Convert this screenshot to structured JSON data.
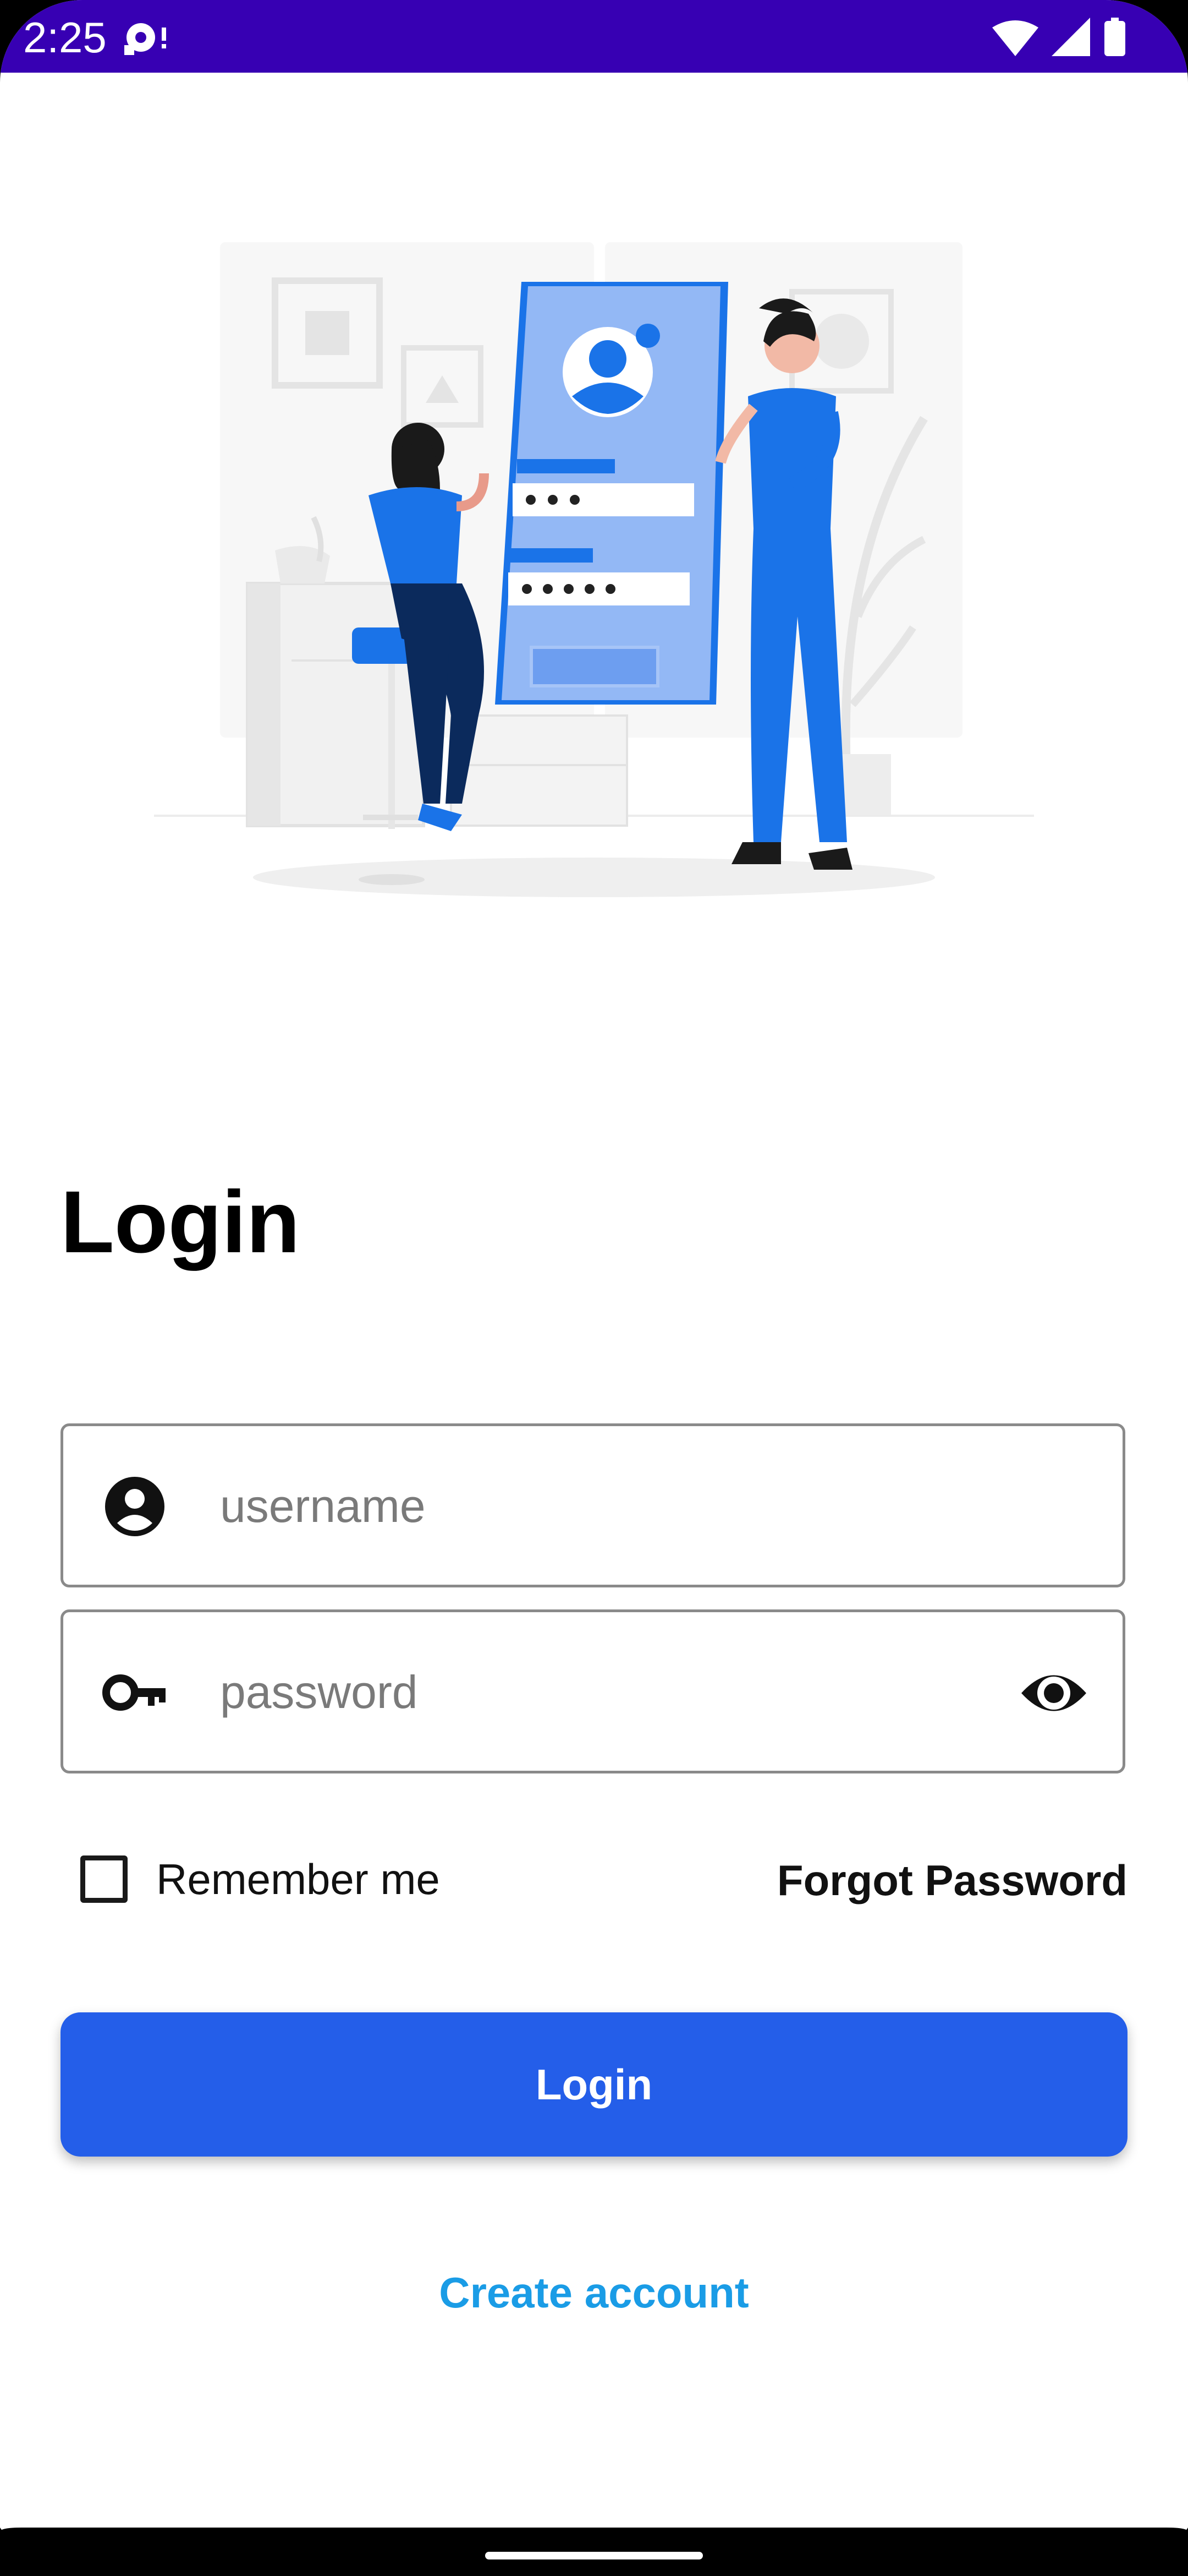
{
  "status_bar": {
    "time": "2:25",
    "icons": [
      "notification-icon",
      "wifi-icon",
      "signal-icon",
      "battery-icon"
    ]
  },
  "illustration": {
    "subject": "login-illustration",
    "colors": {
      "primary_blue": "#1a73e8",
      "light_blue": "#93b8f5",
      "dark_navy": "#0b2a5c",
      "gray": "#e6e6e6"
    }
  },
  "page": {
    "title": "Login"
  },
  "form": {
    "username": {
      "value": "",
      "placeholder": "username",
      "icon": "account-circle-icon"
    },
    "password": {
      "value": "",
      "placeholder": "password",
      "icon": "key-icon",
      "toggle_icon": "eye-icon"
    },
    "remember_me_label": "Remember me",
    "remember_me_checked": false,
    "forgot_password_label": "Forgot Password",
    "login_button_label": "Login",
    "create_account_label": "Create account"
  },
  "colors": {
    "status_bar": "#3700b3",
    "accent": "#245ee9",
    "link": "#1a9ce6"
  }
}
